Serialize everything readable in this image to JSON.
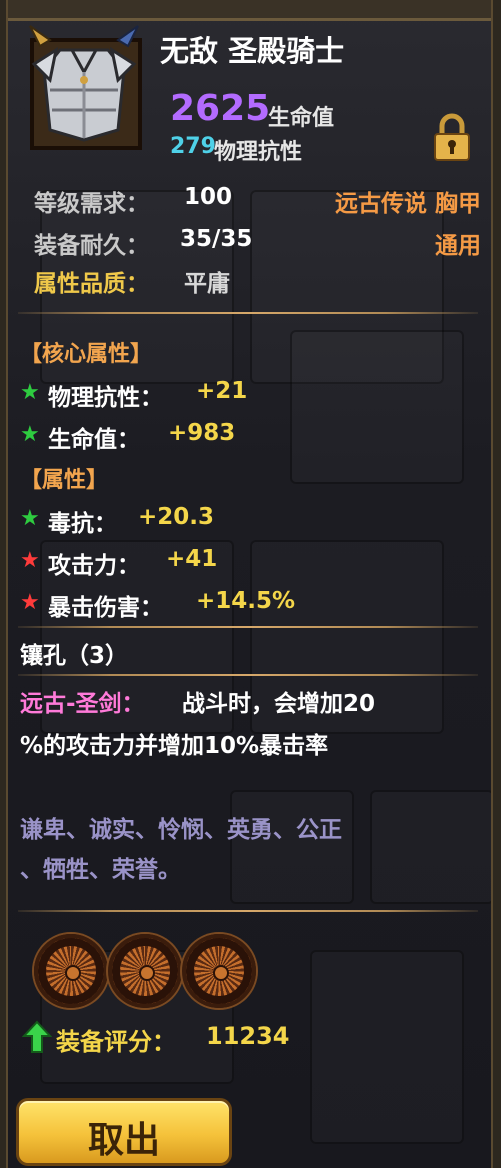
{
  "item": {
    "name": "无敌 圣殿骑士",
    "main_stat_value": "2625",
    "main_stat_label": "生命值",
    "sub_stat_value": "279",
    "sub_stat_label": "物理抗性"
  },
  "requirements": {
    "level_label": "等级需求：",
    "level_value": "100",
    "durability_label": "装备耐久：",
    "durability_value": "35/35",
    "quality_label": "属性品质：",
    "quality_value": "平庸",
    "rarity_type": "远古传说 胸甲",
    "usage": "通用"
  },
  "core_section": {
    "title": "【核心属性】",
    "stats": [
      {
        "name": "物理抗性：",
        "value": "+21",
        "star": "green"
      },
      {
        "name": "生命值：",
        "value": "+983",
        "star": "green"
      }
    ]
  },
  "attr_section": {
    "title": "【属性】",
    "stats": [
      {
        "name": "毒抗：",
        "value": "+20.3",
        "star": "green"
      },
      {
        "name": "攻击力：",
        "value": "+41",
        "star": "red"
      },
      {
        "name": "暴击伤害：",
        "value": "+14.5%",
        "star": "red"
      }
    ]
  },
  "sockets": {
    "label": "镶孔（3）",
    "count": 3
  },
  "set_bonus": {
    "name": "远古-圣剑：",
    "line1": "战斗时，会增加20",
    "line2": "%的攻击力并增加10%暴击率"
  },
  "flavor": {
    "line1": "谦卑、诚实、怜悯、英勇、公正",
    "line2": "、牺牲、荣誉。"
  },
  "score": {
    "label": "装备评分：",
    "value": "11234"
  },
  "buttons": {
    "take_out": "取出"
  },
  "colors": {
    "star_green": "#2ecc40",
    "star_red": "#ff3b3b",
    "purple_value": "#b36bff",
    "cyan_value": "#4fd1e8",
    "set_name": "#ff7ad9",
    "flavor_text": "#9a93c8"
  },
  "icons": {
    "item": "chest-armor-icon",
    "lock": "lock-icon",
    "score_arrow": "green-up-arrow-icon"
  }
}
